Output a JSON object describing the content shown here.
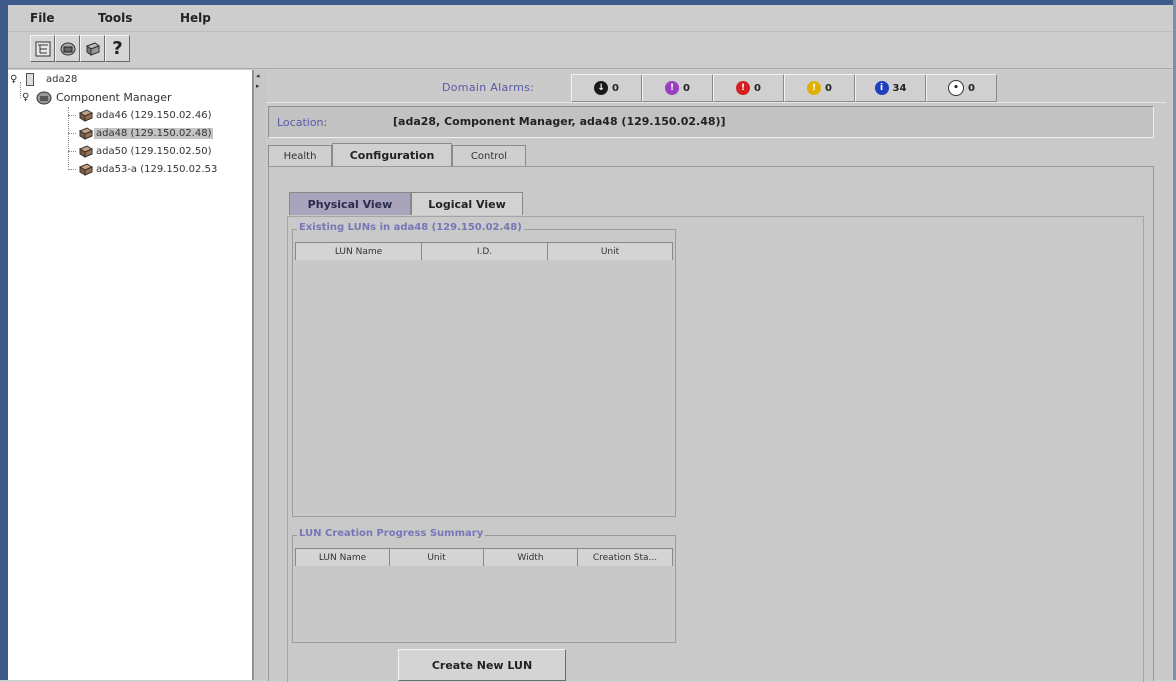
{
  "menubar": {
    "items": [
      "File",
      "Tools",
      "Help"
    ]
  },
  "toolbar": {
    "buttons": [
      "tree-view-icon",
      "domain-icon",
      "server-icon",
      "help-icon"
    ],
    "help_label": "?"
  },
  "tree": {
    "root": "ada28",
    "manager": "Component Manager",
    "items": [
      "ada46 (129.150.02.46)",
      "ada48 (129.150.02.48)",
      "ada50 (129.150.02.50)",
      "ada53-a (129.150.02.53"
    ],
    "selected_index": 1
  },
  "alarms": {
    "label": "Domain Alarms:",
    "items": [
      {
        "icon": "down-alarm-icon",
        "color": "#1a1a1a",
        "glyph": "↓",
        "count": "0"
      },
      {
        "icon": "critical-alarm-icon",
        "color": "#9a3fbf",
        "glyph": "!",
        "count": "0"
      },
      {
        "icon": "major-alarm-icon",
        "color": "#d42020",
        "glyph": "!",
        "count": "0"
      },
      {
        "icon": "minor-alarm-icon",
        "color": "#e0b000",
        "glyph": "!",
        "count": "0"
      },
      {
        "icon": "info-alarm-icon",
        "color": "#1f3fbf",
        "glyph": "i",
        "count": "34"
      },
      {
        "icon": "unknown-alarm-icon",
        "color": "#ffffff",
        "glyph": "•",
        "count": "0"
      }
    ]
  },
  "location": {
    "label": "Location:",
    "value": "[ada28, Component Manager, ada48 (129.150.02.48)]"
  },
  "tabs": [
    "Health",
    "Configuration",
    "Control"
  ],
  "active_tab": "Configuration",
  "subtabs": [
    "Physical View",
    "Logical View"
  ],
  "active_subtab": "Physical View",
  "existing_luns": {
    "title": "Existing LUNs in ada48 (129.150.02.48)",
    "columns": [
      "LUN Name",
      "I.D.",
      "Unit"
    ],
    "rows": []
  },
  "progress": {
    "title": "LUN Creation Progress Summary",
    "columns": [
      "LUN Name",
      "Unit",
      "Width",
      "Creation Sta..."
    ],
    "rows": []
  },
  "create_button": "Create New LUN"
}
